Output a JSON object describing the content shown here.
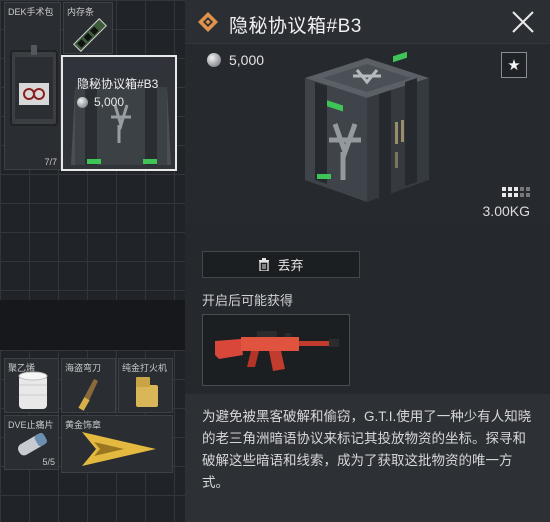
{
  "inventory": {
    "top_items": [
      {
        "label": "DEK手术包",
        "count": "7/7"
      },
      {
        "label": "内存条"
      }
    ],
    "selected": {
      "name": "隐秘协议箱#B3",
      "price": "5,000"
    },
    "bottom_items": [
      {
        "label": "聚乙烯"
      },
      {
        "label": "海盗弯刀"
      },
      {
        "label": "纯金打火机"
      },
      {
        "label": "DVE止痛片",
        "count": "5/5"
      },
      {
        "label": "黄金饰章"
      }
    ]
  },
  "detail": {
    "title": "隐秘协议箱#B3",
    "price": "5,000",
    "favorite_icon": "star-icon",
    "weight": "3.00KG",
    "discard_label": "丢弃",
    "may_get_label": "开启后可能获得",
    "description": "为避免被黑客破解和偷窃，G.T.I.使用了一种少有人知晓的老三角洲暗语协议来标记其投放物资的坐标。探寻和破解这些暗语和线索，成为了获取这批物资的唯一方式。"
  },
  "colors": {
    "accent": "#e0924a",
    "background": "#25282c",
    "highlight": "#e8e8e8",
    "green_latch": "#3ec457"
  }
}
